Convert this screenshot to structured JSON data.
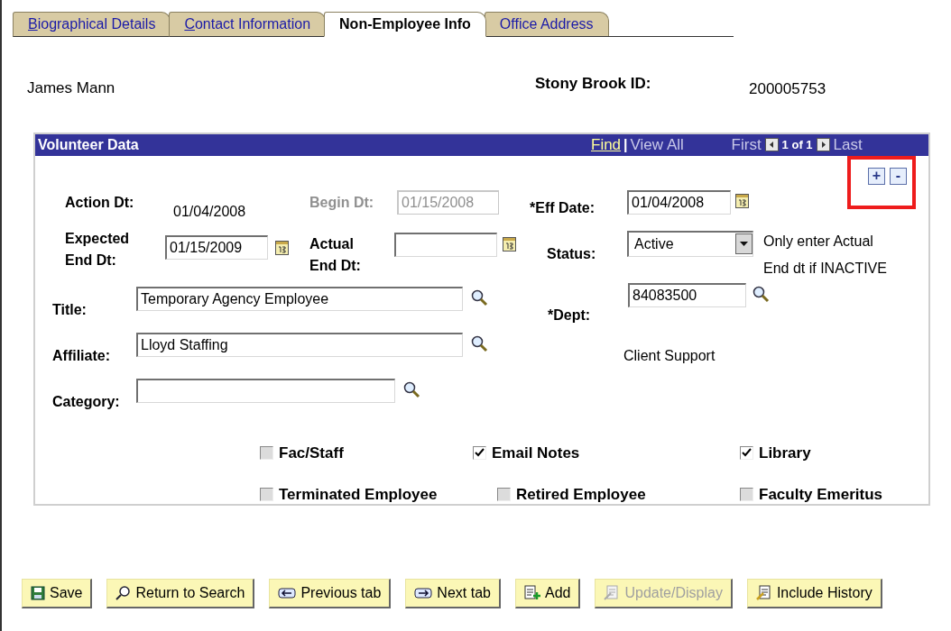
{
  "tabs": [
    {
      "label": "Biographical Details",
      "selected": false,
      "hotkey_underlined": true
    },
    {
      "label": "Contact Information",
      "selected": false,
      "hotkey_underlined": true
    },
    {
      "label": "Non-Employee Info",
      "selected": true,
      "hotkey_underlined": false
    },
    {
      "label": "Office Address",
      "selected": false,
      "hotkey_underlined": false
    }
  ],
  "person": {
    "name": "James Mann",
    "id_label": "Stony Brook ID:",
    "id_value": "200005753"
  },
  "section": {
    "title": "Volunteer Data",
    "find": "Find",
    "separator": "|",
    "view_all": "View All",
    "first": "First",
    "count": "1 of 1",
    "last": "Last",
    "add_row": "+",
    "delete_row": "-"
  },
  "action_dt": {
    "label": "Action Dt:",
    "value": "01/04/2008"
  },
  "begin_dt": {
    "label": "Begin Dt:",
    "value": "01/15/2008",
    "disabled": true
  },
  "eff_date": {
    "label": "*Eff Date:",
    "value": "01/04/2008"
  },
  "expected_end_dt": {
    "label_lines": [
      "Expected",
      "End Dt:"
    ],
    "value": "01/15/2009"
  },
  "actual_end_dt": {
    "label_lines": [
      "Actual",
      "End Dt:"
    ]
  },
  "status": {
    "label": "Status:",
    "value": "Active",
    "note_lines": [
      "Only enter Actual",
      "End dt if INACTIVE"
    ]
  },
  "lookups": [
    {
      "label": "Title:",
      "value": "Temporary Agency Employee",
      "right": {
        "label": "*Dept:",
        "value": "84083500"
      }
    },
    {
      "label": "Affiliate:",
      "value": "Lloyd Staffing",
      "right": {
        "description": "Client Support"
      }
    },
    {
      "label": "Category:",
      "short": true
    }
  ],
  "checkbox_rows": [
    [
      {
        "label": "Fac/Staff",
        "checked": false
      },
      {
        "label": "Email Notes",
        "checked": true
      },
      {
        "label": "Library",
        "checked": true
      }
    ],
    [
      {
        "label": "Terminated Employee",
        "checked": false
      },
      {
        "label": "Retired Employee",
        "checked": false
      },
      {
        "label": "Faculty Emeritus",
        "checked": false
      }
    ]
  ],
  "buttons": [
    {
      "label": "Save",
      "kind": "save",
      "disabled": false
    },
    {
      "label": "Return to Search",
      "kind": "search",
      "disabled": false
    },
    {
      "label": "Previous tab",
      "kind": "prev",
      "disabled": false
    },
    {
      "label": "Next tab",
      "kind": "next",
      "disabled": false
    },
    {
      "label": "Add",
      "kind": "add",
      "disabled": false
    },
    {
      "label": "Update/Display",
      "kind": "update",
      "disabled": true
    },
    {
      "label": "Include History",
      "kind": "history",
      "disabled": false
    }
  ]
}
